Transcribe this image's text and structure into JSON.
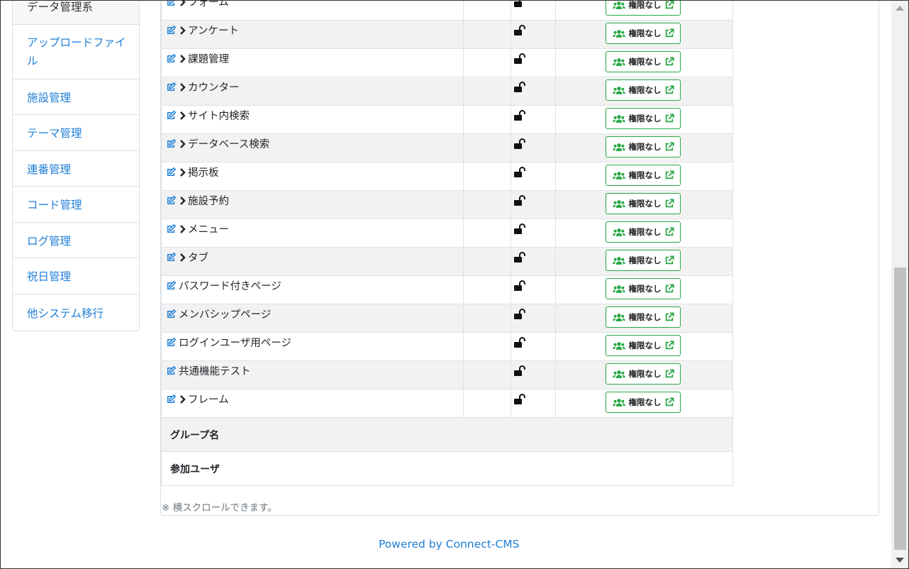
{
  "sidebar": {
    "items": [
      {
        "label": "データ管理系",
        "active": true
      },
      {
        "label": "アップロードファイル"
      },
      {
        "label": "施設管理"
      },
      {
        "label": "テーマ管理"
      },
      {
        "label": "連番管理"
      },
      {
        "label": "コード管理"
      },
      {
        "label": "ログ管理"
      },
      {
        "label": "祝日管理"
      },
      {
        "label": "他システム移行"
      }
    ]
  },
  "table": {
    "permission_label": "権限なし",
    "rows": [
      {
        "name": "フォーム",
        "has_children": true
      },
      {
        "name": "アンケート",
        "has_children": true
      },
      {
        "name": "課題管理",
        "has_children": true
      },
      {
        "name": "カウンター",
        "has_children": true
      },
      {
        "name": "サイト内検索",
        "has_children": true
      },
      {
        "name": "データベース検索",
        "has_children": true
      },
      {
        "name": "掲示板",
        "has_children": true
      },
      {
        "name": "施設予約",
        "has_children": true
      },
      {
        "name": "メニュー",
        "has_children": true
      },
      {
        "name": "タブ",
        "has_children": true
      },
      {
        "name": "パスワード付きページ",
        "has_children": false
      },
      {
        "name": "メンバシップページ",
        "has_children": false
      },
      {
        "name": "ログインユーザ用ページ",
        "has_children": false
      },
      {
        "name": "共通機能テスト",
        "has_children": false
      },
      {
        "name": "フレーム",
        "has_children": true
      }
    ],
    "group_name_label": "グループ名",
    "members_label": "参加ユーザ"
  },
  "note": "※ 横スクロールできます。",
  "footer": "Powered by Connect-CMS",
  "colors": {
    "link": "#1f7fd6",
    "success": "#28a745",
    "stripe": "#f2f2f2"
  },
  "icons": {
    "edit": "edit-icon",
    "chevron": "chevron-right-icon",
    "lock": "unlock-icon",
    "users": "users-icon",
    "external": "external-link-icon"
  }
}
